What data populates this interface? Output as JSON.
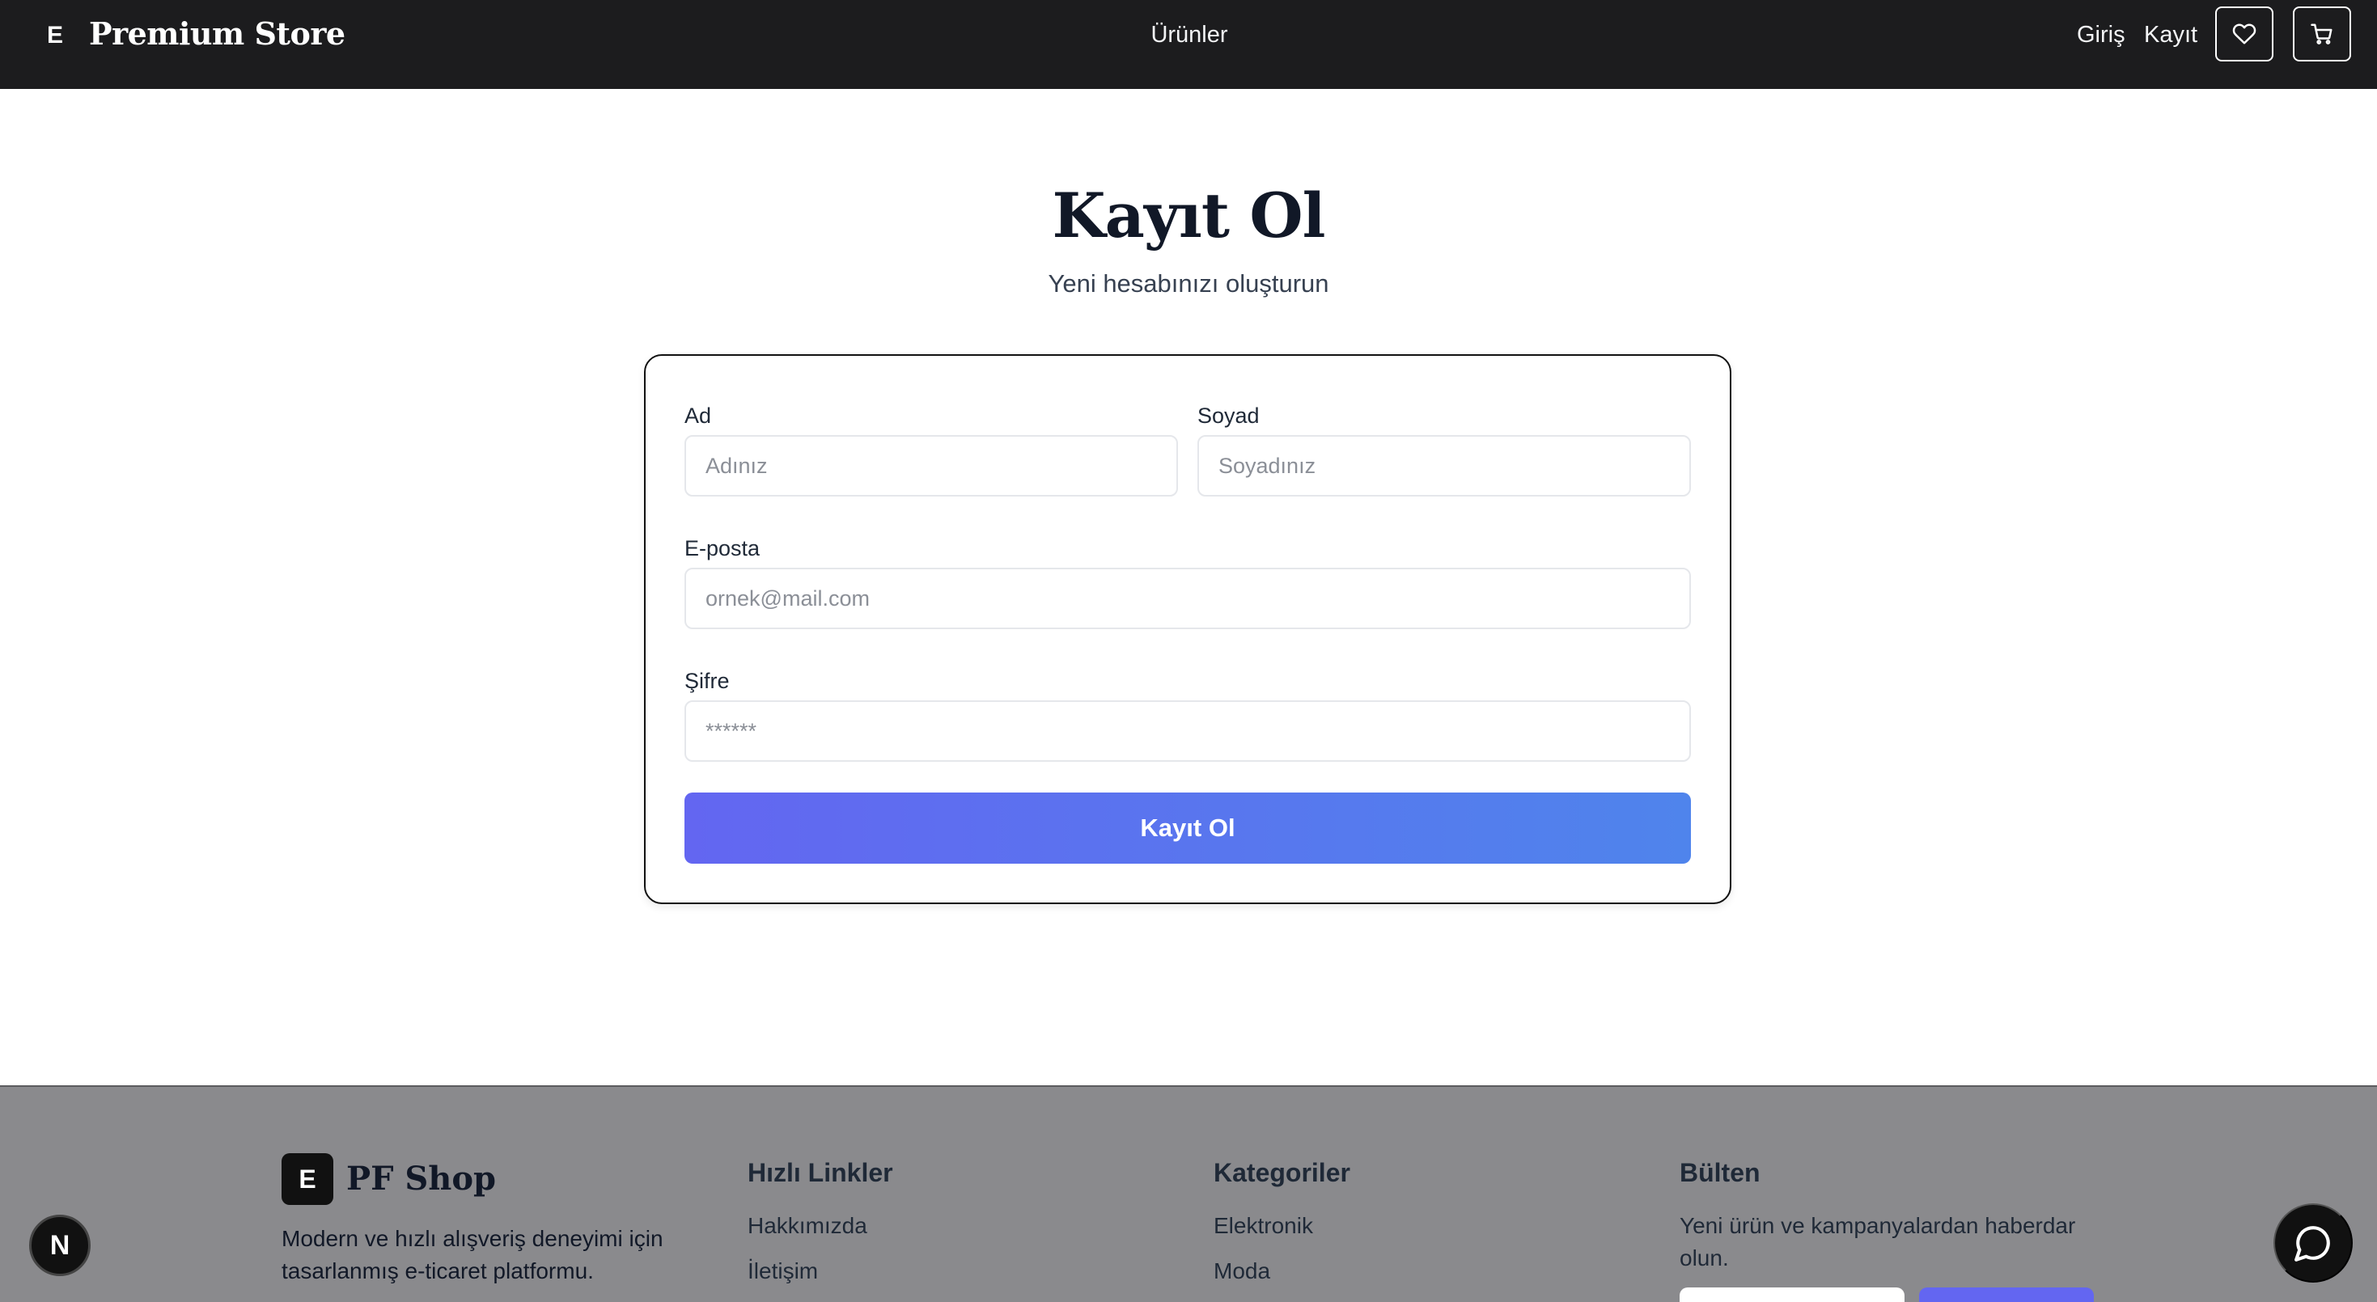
{
  "navbar": {
    "logo_mark": "E",
    "brand": "Premium Store",
    "center_link": "Ürünler",
    "login": "Giriş",
    "register": "Kayıt",
    "wishlist_icon": "heart-icon",
    "cart_icon": "cart-icon"
  },
  "page": {
    "title": "Kayıt Ol",
    "subtitle": "Yeni hesabınızı oluşturun"
  },
  "form": {
    "first_name": {
      "label": "Ad",
      "placeholder": "Adınız",
      "value": ""
    },
    "last_name": {
      "label": "Soyad",
      "placeholder": "Soyadınız",
      "value": ""
    },
    "email": {
      "label": "E-posta",
      "placeholder": "ornek@mail.com",
      "value": ""
    },
    "password": {
      "label": "Şifre",
      "placeholder": "******",
      "value": ""
    },
    "submit": "Kayıt Ol"
  },
  "footer": {
    "logo_mark": "E",
    "brand": "PF Shop",
    "description": "Modern ve hızlı alışveriş deneyimi için tasarlanmış e-ticaret platformu.",
    "quick_links": {
      "heading": "Hızlı Linkler",
      "items": [
        "Hakkımızda",
        "İletişim"
      ]
    },
    "categories": {
      "heading": "Kategoriler",
      "items": [
        "Elektronik",
        "Moda"
      ]
    },
    "newsletter": {
      "heading": "Bülten",
      "text": "Yeni ürün ve kampanyalardan haberdar olun."
    }
  },
  "floating": {
    "dev_badge": "N",
    "chat_icon": "chat-bubble-icon"
  },
  "colors": {
    "navbar_bg": "#1c1c1e",
    "button_gradient_start": "#6366f1",
    "button_gradient_end": "#4f84ec",
    "footer_bg": "#8a8a8d"
  }
}
